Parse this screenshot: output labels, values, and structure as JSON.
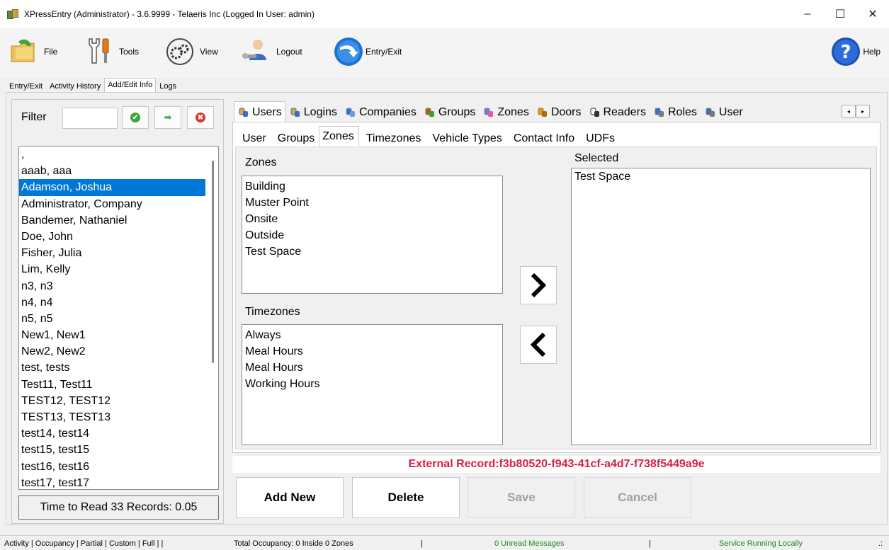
{
  "window": {
    "title": "XPressEntry (Administrator)  - 3.6.9999 - Telaeris Inc (Logged In User: admin)",
    "minimize": "–",
    "maximize": "☐",
    "close": "✕"
  },
  "toolbar": {
    "file": "File",
    "tools": "Tools",
    "view": "View",
    "logout": "Logout",
    "entry_exit": "Entry/Exit",
    "help": "Help",
    "help_glyph": "?"
  },
  "main_tabs": [
    "Entry/Exit",
    "Activity History",
    "Add/Edit Info",
    "Logs"
  ],
  "filter": {
    "label": "Filter",
    "value": "",
    "apply_glyph": "✔",
    "next_glyph": "➡",
    "clear_glyph": "✖"
  },
  "users": [
    ",",
    "aaab, aaa",
    "Adamson, Joshua",
    "Administrator, Company",
    "Bandemer, Nathaniel",
    "Doe, John",
    "Fisher, Julia",
    "Lim, Kelly",
    "n3, n3",
    "n4, n4",
    "n5, n5",
    "New1, New1",
    "New2, New2",
    "test, tests",
    "Test11, Test11",
    "TEST12, TEST12",
    "TEST13, TEST13",
    "test14, test14",
    "test15, test15",
    "test16, test16",
    "test17, test17"
  ],
  "selected_user_index": 2,
  "read_status": "Time to Read 33 Records: 0.05",
  "tabs": [
    {
      "label": "Users",
      "icon": "users-icon",
      "active": true
    },
    {
      "label": "Logins",
      "icon": "logins-icon"
    },
    {
      "label": "Companies",
      "icon": "companies-icon"
    },
    {
      "label": "Groups",
      "icon": "groups-icon"
    },
    {
      "label": "Zones",
      "icon": "zones-icon"
    },
    {
      "label": "Doors",
      "icon": "door-icon"
    },
    {
      "label": "Readers",
      "icon": "reader-icon"
    },
    {
      "label": "Roles",
      "icon": "roles-icon"
    },
    {
      "label": "User",
      "icon": "user-icon"
    }
  ],
  "tab_scroll": {
    "left": "◂",
    "right": "▸"
  },
  "subtabs": [
    "User",
    "Groups",
    "Zones",
    "Timezones",
    "Vehicle Types",
    "Contact Info",
    "UDFs"
  ],
  "active_subtab": 2,
  "zones_panel": {
    "zones_label": "Zones",
    "zones": [
      "Building",
      "Muster Point",
      "Onsite",
      "Outside",
      "Test Space"
    ],
    "timezones_label": "Timezones",
    "timezones": [
      "Always",
      "Meal Hours",
      "Meal Hours",
      "Working Hours"
    ],
    "selected_label": "Selected",
    "selected": [
      "Test Space"
    ]
  },
  "external_record": "External Record:f3b80520-f943-41cf-a4d7-f738f5449a9e",
  "actions": {
    "add_new": "Add New",
    "delete": "Delete",
    "save": "Save",
    "cancel": "Cancel"
  },
  "statusbar": {
    "modes": "Activity | Occupancy | Partial | Custom | Full | |",
    "occupancy": "Total Occupancy: 0 Inside 0 Zones",
    "sep1": "|",
    "messages": "0 Unread Messages",
    "sep2": "|",
    "service": "Service Running Locally",
    "grip": ".:"
  },
  "colors": {
    "selection": "#0078d7",
    "external_record": "#d81f45",
    "status_ok": "#1a8a1a"
  }
}
